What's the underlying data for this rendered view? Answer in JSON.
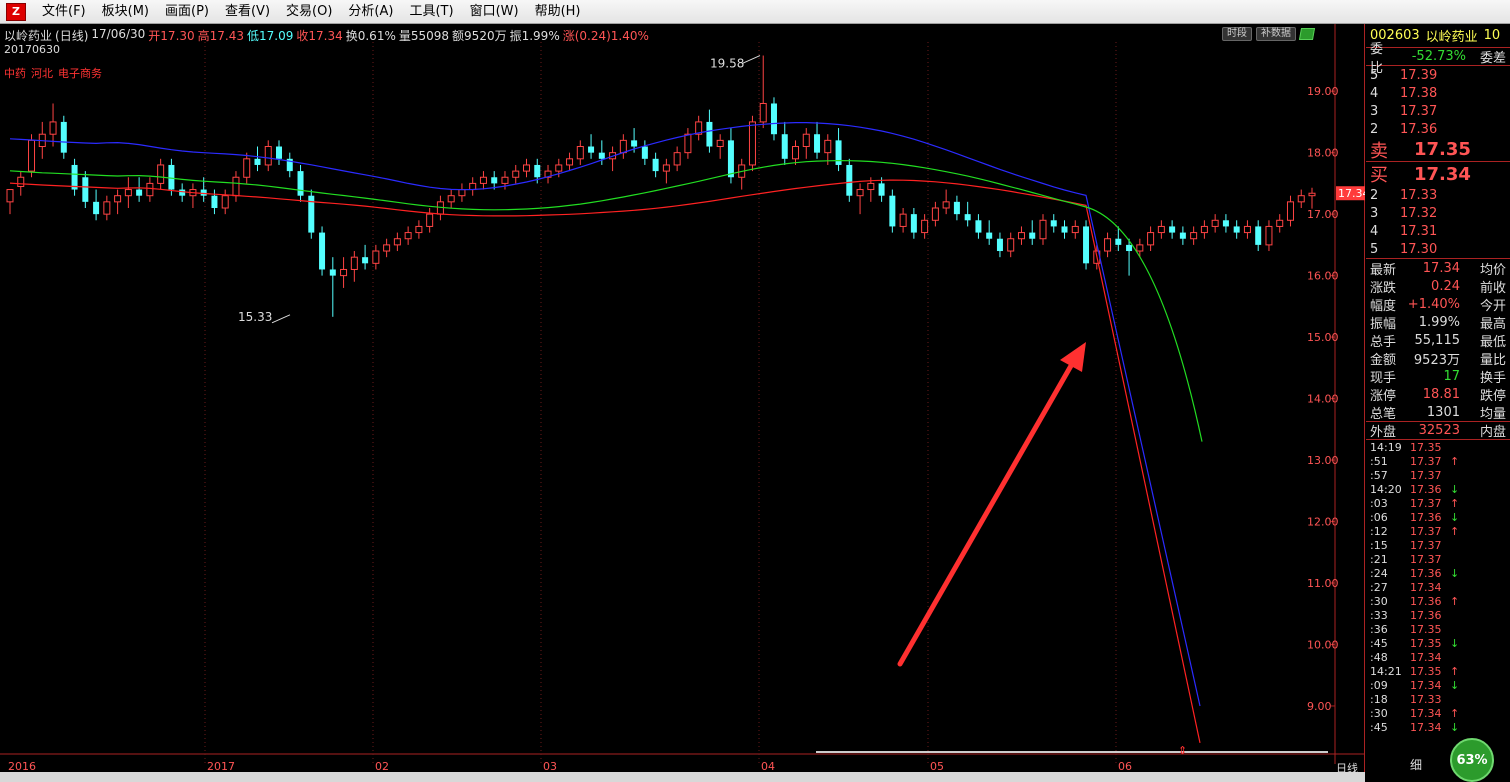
{
  "menu": [
    "文件(F)",
    "板块(M)",
    "画面(P)",
    "查看(V)",
    "交易(O)",
    "分析(A)",
    "工具(T)",
    "窗口(W)",
    "帮助(H)"
  ],
  "chart_header": {
    "name": "以岭药业",
    "period": "(日线)",
    "date": "17/06/30",
    "open": "开17.30",
    "high": "高17.43",
    "low": "低17.09",
    "close": "收17.34",
    "turnover": "换0.61%",
    "volume": "量55098",
    "amount": "额9520万",
    "amplitude": "振1.99%",
    "change": "涨(0.24)1.40%",
    "date_code": "20170630",
    "tags": [
      "中药",
      "河北",
      "电子商务"
    ],
    "btn_time": "时段",
    "btn_fill": "补数据"
  },
  "chart_data": {
    "type": "candlestick",
    "y_ticks": [
      "19.00",
      "18.00",
      "17.00",
      "16.00",
      "15.00",
      "14.00",
      "13.00",
      "12.00",
      "11.00",
      "10.00",
      "9.00"
    ],
    "ylim": [
      8.3,
      19.8
    ],
    "x_labels": [
      "2016",
      "2017",
      "02",
      "03",
      "04",
      "05",
      "06"
    ],
    "annotations": {
      "high": "19.58",
      "low": "15.33",
      "current": "17.34"
    },
    "ohlc": [
      [
        17.2,
        17.4,
        17.0,
        17.4
      ],
      [
        17.45,
        17.7,
        17.3,
        17.6
      ],
      [
        17.7,
        18.3,
        17.6,
        18.2
      ],
      [
        18.1,
        18.5,
        17.9,
        18.3
      ],
      [
        18.3,
        18.8,
        18.1,
        18.5
      ],
      [
        18.5,
        18.6,
        17.9,
        18.0
      ],
      [
        17.8,
        17.9,
        17.3,
        17.4
      ],
      [
        17.6,
        17.7,
        17.1,
        17.2
      ],
      [
        17.2,
        17.4,
        16.9,
        17.0
      ],
      [
        17.0,
        17.3,
        16.9,
        17.2
      ],
      [
        17.2,
        17.4,
        17.0,
        17.3
      ],
      [
        17.3,
        17.6,
        17.1,
        17.4
      ],
      [
        17.4,
        17.6,
        17.2,
        17.3
      ],
      [
        17.3,
        17.6,
        17.2,
        17.5
      ],
      [
        17.5,
        17.9,
        17.4,
        17.8
      ],
      [
        17.8,
        17.9,
        17.3,
        17.4
      ],
      [
        17.4,
        17.5,
        17.2,
        17.3
      ],
      [
        17.3,
        17.5,
        17.1,
        17.4
      ],
      [
        17.4,
        17.6,
        17.2,
        17.3
      ],
      [
        17.3,
        17.4,
        17.0,
        17.1
      ],
      [
        17.1,
        17.4,
        17.0,
        17.3
      ],
      [
        17.3,
        17.7,
        17.2,
        17.6
      ],
      [
        17.6,
        18.0,
        17.5,
        17.9
      ],
      [
        17.9,
        18.1,
        17.7,
        17.8
      ],
      [
        17.8,
        18.2,
        17.7,
        18.1
      ],
      [
        18.1,
        18.2,
        17.8,
        17.9
      ],
      [
        17.9,
        18.0,
        17.6,
        17.7
      ],
      [
        17.7,
        17.8,
        17.2,
        17.3
      ],
      [
        17.3,
        17.4,
        16.6,
        16.7
      ],
      [
        16.7,
        16.8,
        16.0,
        16.1
      ],
      [
        16.1,
        16.3,
        15.33,
        16.0
      ],
      [
        16.0,
        16.3,
        15.8,
        16.1
      ],
      [
        16.1,
        16.4,
        15.9,
        16.3
      ],
      [
        16.3,
        16.5,
        16.1,
        16.2
      ],
      [
        16.2,
        16.5,
        16.1,
        16.4
      ],
      [
        16.4,
        16.6,
        16.3,
        16.5
      ],
      [
        16.5,
        16.7,
        16.4,
        16.6
      ],
      [
        16.6,
        16.8,
        16.5,
        16.7
      ],
      [
        16.7,
        16.9,
        16.6,
        16.8
      ],
      [
        16.8,
        17.1,
        16.7,
        17.0
      ],
      [
        17.0,
        17.3,
        16.9,
        17.2
      ],
      [
        17.2,
        17.4,
        17.1,
        17.3
      ],
      [
        17.3,
        17.5,
        17.2,
        17.4
      ],
      [
        17.4,
        17.6,
        17.3,
        17.5
      ],
      [
        17.5,
        17.7,
        17.4,
        17.6
      ],
      [
        17.6,
        17.7,
        17.4,
        17.5
      ],
      [
        17.5,
        17.7,
        17.4,
        17.6
      ],
      [
        17.6,
        17.8,
        17.5,
        17.7
      ],
      [
        17.7,
        17.9,
        17.6,
        17.8
      ],
      [
        17.8,
        17.9,
        17.5,
        17.6
      ],
      [
        17.6,
        17.8,
        17.5,
        17.7
      ],
      [
        17.7,
        17.9,
        17.6,
        17.8
      ],
      [
        17.8,
        18.0,
        17.7,
        17.9
      ],
      [
        17.9,
        18.2,
        17.8,
        18.1
      ],
      [
        18.1,
        18.3,
        17.9,
        18.0
      ],
      [
        18.0,
        18.2,
        17.8,
        17.9
      ],
      [
        17.9,
        18.1,
        17.7,
        18.0
      ],
      [
        18.0,
        18.3,
        17.9,
        18.2
      ],
      [
        18.2,
        18.4,
        18.0,
        18.1
      ],
      [
        18.1,
        18.2,
        17.8,
        17.9
      ],
      [
        17.9,
        18.0,
        17.6,
        17.7
      ],
      [
        17.7,
        17.9,
        17.5,
        17.8
      ],
      [
        17.8,
        18.1,
        17.7,
        18.0
      ],
      [
        18.0,
        18.4,
        17.9,
        18.3
      ],
      [
        18.3,
        18.6,
        18.2,
        18.5
      ],
      [
        18.5,
        18.7,
        18.0,
        18.1
      ],
      [
        18.1,
        18.3,
        17.9,
        18.2
      ],
      [
        18.2,
        18.4,
        17.5,
        17.6
      ],
      [
        17.6,
        17.9,
        17.4,
        17.8
      ],
      [
        17.8,
        18.6,
        17.7,
        18.5
      ],
      [
        18.5,
        19.58,
        18.4,
        18.8
      ],
      [
        18.8,
        18.9,
        18.2,
        18.3
      ],
      [
        18.3,
        18.5,
        17.8,
        17.9
      ],
      [
        17.9,
        18.2,
        17.8,
        18.1
      ],
      [
        18.1,
        18.4,
        17.9,
        18.3
      ],
      [
        18.3,
        18.5,
        17.9,
        18.0
      ],
      [
        18.0,
        18.3,
        17.8,
        18.2
      ],
      [
        18.2,
        18.4,
        17.7,
        17.8
      ],
      [
        17.8,
        17.9,
        17.2,
        17.3
      ],
      [
        17.3,
        17.5,
        17.0,
        17.4
      ],
      [
        17.4,
        17.6,
        17.2,
        17.5
      ],
      [
        17.5,
        17.6,
        17.2,
        17.3
      ],
      [
        17.3,
        17.4,
        16.7,
        16.8
      ],
      [
        16.8,
        17.1,
        16.7,
        17.0
      ],
      [
        17.0,
        17.1,
        16.6,
        16.7
      ],
      [
        16.7,
        17.0,
        16.6,
        16.9
      ],
      [
        16.9,
        17.2,
        16.8,
        17.1
      ],
      [
        17.1,
        17.4,
        17.0,
        17.2
      ],
      [
        17.2,
        17.3,
        16.9,
        17.0
      ],
      [
        17.0,
        17.2,
        16.8,
        16.9
      ],
      [
        16.9,
        17.0,
        16.6,
        16.7
      ],
      [
        16.7,
        16.9,
        16.5,
        16.6
      ],
      [
        16.6,
        16.7,
        16.3,
        16.4
      ],
      [
        16.4,
        16.7,
        16.3,
        16.6
      ],
      [
        16.6,
        16.8,
        16.5,
        16.7
      ],
      [
        16.7,
        16.9,
        16.5,
        16.6
      ],
      [
        16.6,
        17.0,
        16.5,
        16.9
      ],
      [
        16.9,
        17.0,
        16.7,
        16.8
      ],
      [
        16.8,
        16.9,
        16.6,
        16.7
      ],
      [
        16.7,
        16.9,
        16.6,
        16.8
      ],
      [
        16.8,
        16.9,
        16.1,
        16.2
      ],
      [
        16.2,
        16.5,
        16.1,
        16.4
      ],
      [
        16.4,
        16.7,
        16.3,
        16.6
      ],
      [
        16.6,
        16.8,
        16.4,
        16.5
      ],
      [
        16.5,
        16.6,
        16.0,
        16.4
      ],
      [
        16.4,
        16.6,
        16.3,
        16.5
      ],
      [
        16.5,
        16.8,
        16.4,
        16.7
      ],
      [
        16.7,
        16.9,
        16.6,
        16.8
      ],
      [
        16.8,
        16.9,
        16.6,
        16.7
      ],
      [
        16.7,
        16.8,
        16.5,
        16.6
      ],
      [
        16.6,
        16.8,
        16.5,
        16.7
      ],
      [
        16.7,
        16.9,
        16.6,
        16.8
      ],
      [
        16.8,
        17.0,
        16.7,
        16.9
      ],
      [
        16.9,
        17.0,
        16.7,
        16.8
      ],
      [
        16.8,
        16.9,
        16.6,
        16.7
      ],
      [
        16.7,
        16.9,
        16.6,
        16.8
      ],
      [
        16.8,
        16.9,
        16.4,
        16.5
      ],
      [
        16.5,
        16.9,
        16.4,
        16.8
      ],
      [
        16.8,
        17.0,
        16.7,
        16.9
      ],
      [
        16.9,
        17.3,
        16.8,
        17.2
      ],
      [
        17.2,
        17.4,
        17.1,
        17.3
      ],
      [
        17.3,
        17.43,
        17.09,
        17.34
      ]
    ],
    "ma_blue_end": 9.0,
    "ma_red_end": 8.4,
    "ma_green_end": 13.3
  },
  "panel": {
    "code": "002603",
    "name": "以岭药业",
    "extra": "10",
    "weibi_label": "委比",
    "weibi_val": "-52.73%",
    "weicha_label": "委差",
    "sell": [
      [
        "5",
        "17.39"
      ],
      [
        "4",
        "17.38"
      ],
      [
        "3",
        "17.37"
      ],
      [
        "2",
        "17.36"
      ]
    ],
    "sell1_label": "卖",
    "sell1_price": "17.35",
    "buy1_label": "买",
    "buy1_price": "17.34",
    "buy": [
      [
        "2",
        "17.33"
      ],
      [
        "3",
        "17.32"
      ],
      [
        "4",
        "17.31"
      ],
      [
        "5",
        "17.30"
      ]
    ],
    "stats": [
      [
        "最新",
        "17.34",
        "均价"
      ],
      [
        "涨跌",
        "0.24",
        "前收"
      ],
      [
        "幅度",
        "+1.40%",
        "今开"
      ],
      [
        "振幅",
        "1.99%",
        "最高"
      ],
      [
        "总手",
        "55,115",
        "最低"
      ],
      [
        "金额",
        "9523万",
        "量比"
      ],
      [
        "现手",
        "17",
        "换手"
      ],
      [
        "涨停",
        "18.81",
        "跌停"
      ],
      [
        "总笔",
        "1301",
        "均量"
      ]
    ],
    "outer_label": "外盘",
    "outer_val": "32523",
    "inner_label": "内盘",
    "ticks": [
      [
        "14:19",
        "17.35",
        ""
      ],
      [
        ":51",
        "17.37",
        "up"
      ],
      [
        ":57",
        "17.37",
        ""
      ],
      [
        "14:20",
        "17.36",
        "dn"
      ],
      [
        ":03",
        "17.37",
        "up"
      ],
      [
        ":06",
        "17.36",
        "dn"
      ],
      [
        ":12",
        "17.37",
        "up"
      ],
      [
        ":15",
        "17.37",
        ""
      ],
      [
        ":21",
        "17.37",
        ""
      ],
      [
        ":24",
        "17.36",
        "dn"
      ],
      [
        ":27",
        "17.34",
        ""
      ],
      [
        ":30",
        "17.36",
        "up"
      ],
      [
        ":33",
        "17.36",
        ""
      ],
      [
        ":36",
        "17.35",
        ""
      ],
      [
        ":45",
        "17.35",
        "dn"
      ],
      [
        ":48",
        "17.34",
        ""
      ],
      [
        "14:21",
        "17.35",
        "up"
      ],
      [
        ":09",
        "17.34",
        "dn"
      ],
      [
        ":18",
        "17.33",
        ""
      ],
      [
        ":30",
        "17.34",
        "up"
      ],
      [
        ":45",
        "17.34",
        "dn"
      ]
    ],
    "bottom_label": "细",
    "pct": "63%"
  },
  "axis_side_label": "日线"
}
